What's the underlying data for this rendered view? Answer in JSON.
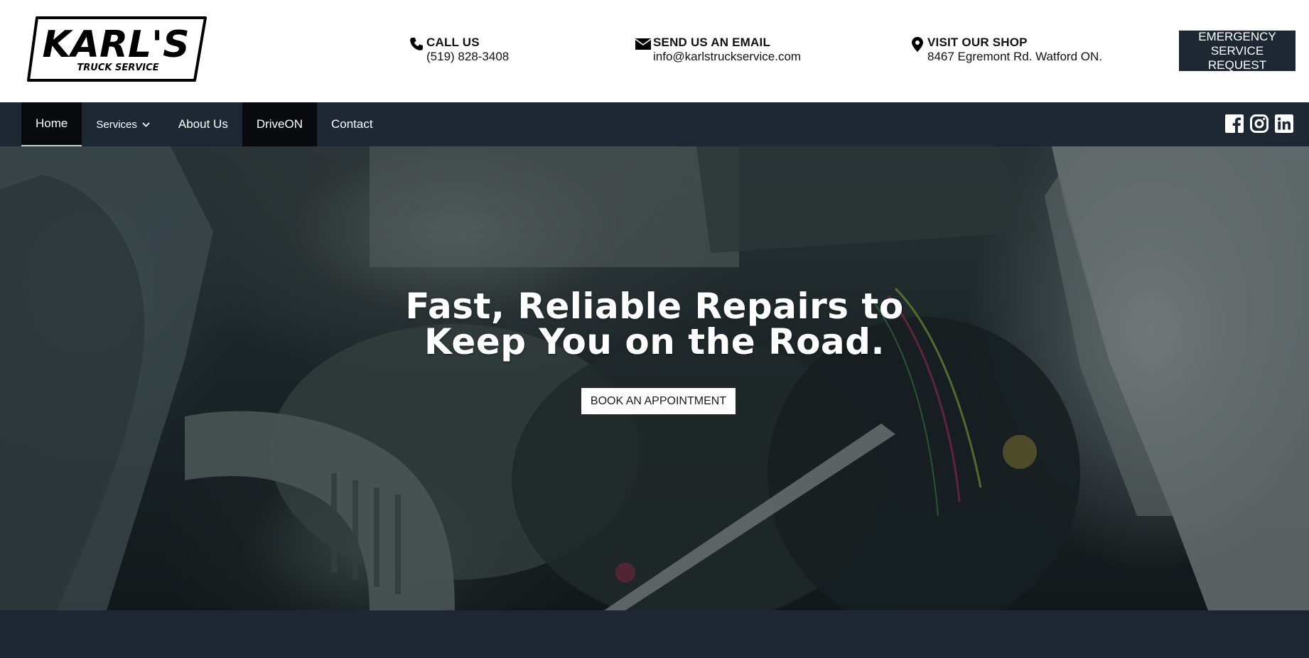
{
  "brand": {
    "name": "KARL'S",
    "tagline": "TRUCK SERVICE"
  },
  "contacts": {
    "call": {
      "title": "CALL US",
      "value": "(519) 828-3408",
      "icon": "phone-icon"
    },
    "email": {
      "title": "SEND US AN EMAIL",
      "value": "info@karlstruckservice.com",
      "icon": "envelope-icon"
    },
    "visit": {
      "title": "VISIT OUR SHOP",
      "value": "8467 Egremont Rd. Watford ON.",
      "icon": "map-pin-icon"
    }
  },
  "emergency_button": "EMERGENCY SERVICE REQUEST",
  "nav": {
    "items": [
      {
        "label": "Home"
      },
      {
        "label": "Services"
      },
      {
        "label": "About Us"
      },
      {
        "label": "DriveON"
      },
      {
        "label": "Contact"
      }
    ],
    "social": [
      "facebook-icon",
      "instagram-icon",
      "linkedin-icon"
    ]
  },
  "hero": {
    "title_line1": "Fast, Reliable Repairs to",
    "title_line2": "Keep You on the Road.",
    "cta": "BOOK AN APPOINTMENT",
    "image": "truck-engine-photo"
  },
  "colors": {
    "navy": "#1e2835",
    "nav_active": "#080a0d",
    "white": "#ffffff"
  }
}
